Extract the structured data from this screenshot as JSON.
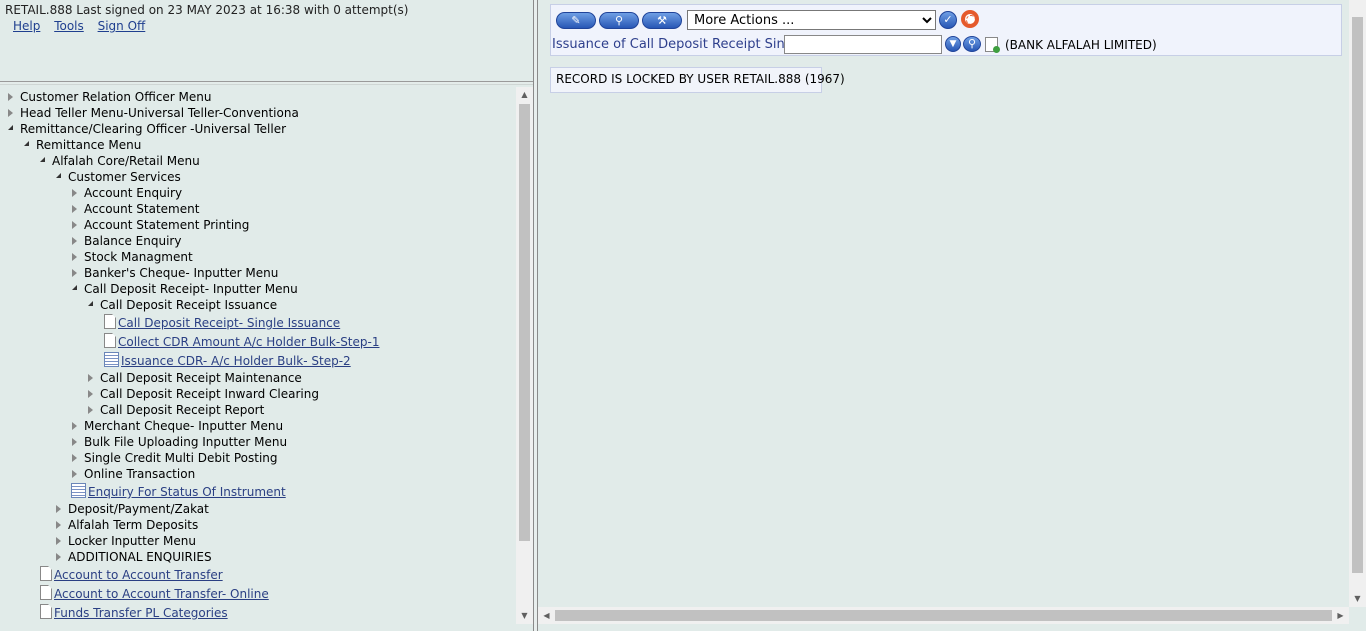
{
  "banner": {
    "signon_text": "RETAIL.888 Last signed on 23 MAY 2023 at 16:38 with 0 attempt(s)",
    "links": [
      "Help",
      "Tools",
      "Sign Off"
    ]
  },
  "tree": {
    "l1_0": "Customer Relation Officer Menu",
    "l1_1": "Head Teller Menu-Universal Teller-Conventiona",
    "l1_2": "Remittance/Clearing Officer -Universal Teller",
    "l2_0": "Remittance Menu",
    "l3_0": "Alfalah Core/Retail Menu",
    "l4_0": "Customer Services",
    "cs": [
      "Account Enquiry",
      "Account Statement",
      "Account Statement Printing",
      "Balance Enquiry",
      "Stock Managment",
      "Banker's Cheque- Inputter Menu",
      "Call Deposit Receipt- Inputter Menu"
    ],
    "cdr_issuance": "Call Deposit Receipt Issuance",
    "issuance_links": [
      "Call Deposit Receipt- Single Issuance",
      "Collect CDR Amount A/c Holder Bulk-Step-1",
      "Issuance CDR- A/c Holder Bulk- Step-2"
    ],
    "cdr_more": [
      "Call Deposit Receipt Maintenance",
      "Call Deposit Receipt Inward Clearing",
      "Call Deposit Receipt Report"
    ],
    "cs_more": [
      "Merchant Cheque- Inputter Menu",
      "Bulk File Uploading Inputter Menu",
      "Single Credit Multi Debit Posting",
      "Online Transaction"
    ],
    "enquiry_link": "Enquiry For Status Of Instrument",
    "l4_more": [
      "Deposit/Payment/Zakat",
      "Alfalah Term Deposits",
      "Locker Inputter Menu",
      "ADDITIONAL ENQUIRIES"
    ],
    "transfer_links": [
      "Account to Account Transfer",
      "Account to Account Transfer- Online",
      "Funds Transfer PL Categories"
    ]
  },
  "toolbar": {
    "more_actions": "More Actions ...",
    "version_label": "Issuance of Call Deposit Receipt Single",
    "txn_value": "",
    "company": "(BANK ALFALAH LIMITED)"
  },
  "message": "RECORD IS LOCKED BY USER RETAIL.888 (1967)",
  "icons": {
    "edit": "pencil-icon",
    "view": "magnifier-icon",
    "tools": "wrench-icon",
    "go": "checkmark-icon",
    "help": "lifebuoy-icon",
    "dropdown": "chevron-down-icon",
    "find": "find-icon",
    "new_deal": "new-document-icon"
  }
}
